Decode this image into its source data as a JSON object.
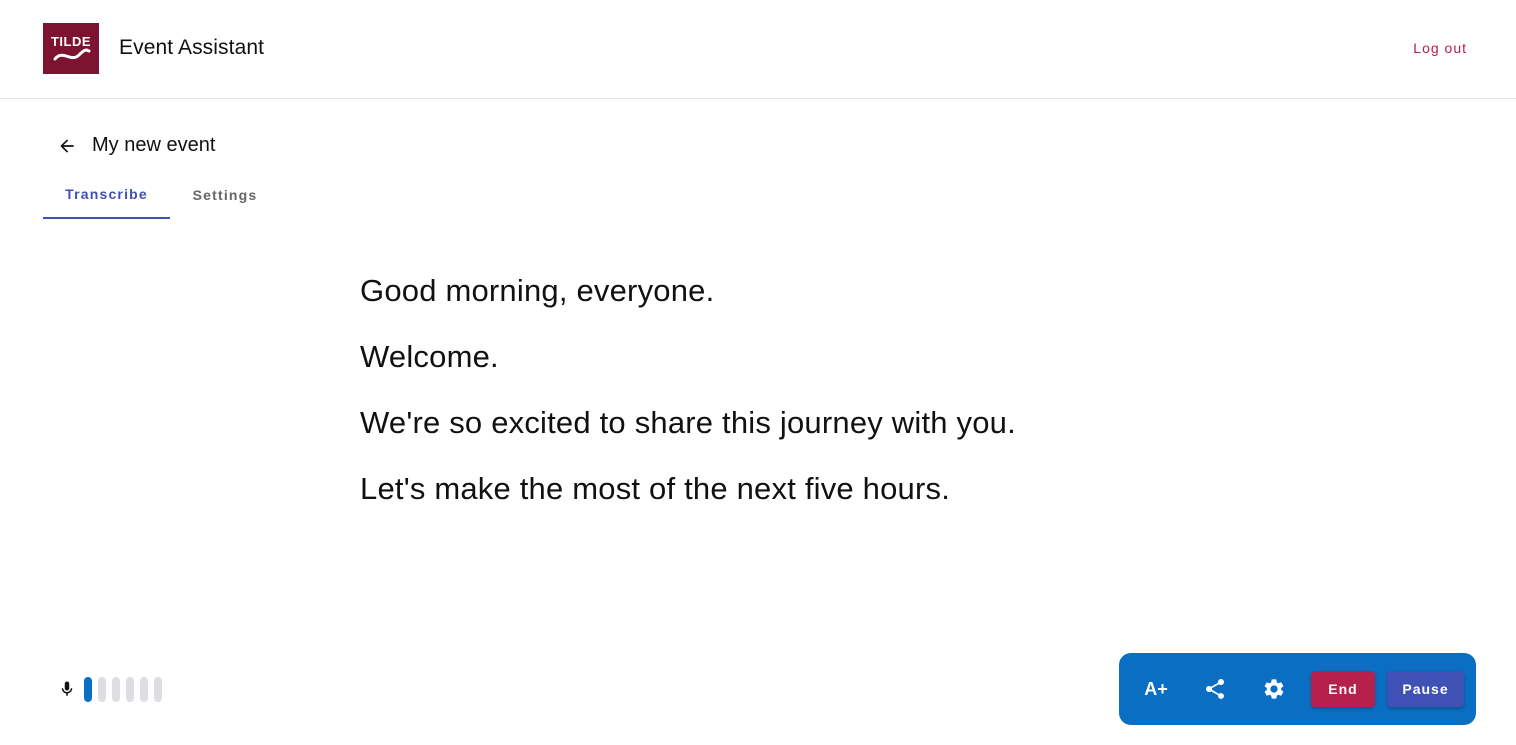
{
  "header": {
    "logo_text": "TILDE",
    "app_title": "Event Assistant",
    "logout_label": "Log out"
  },
  "event": {
    "back_icon": "arrow-left-icon",
    "title": "My new event"
  },
  "tabs": [
    {
      "label": "Transcribe",
      "active": true
    },
    {
      "label": "Settings",
      "active": false
    }
  ],
  "transcript": {
    "lines": [
      "Good morning, everyone.",
      "Welcome.",
      "We're so excited to share this journey with you.",
      "Let's make the most of the next five hours."
    ]
  },
  "mic_level": {
    "icon": "microphone-icon",
    "segments_total": 6,
    "segments_active": 1
  },
  "controls": {
    "font_size_label": "A+",
    "share_icon": "share-icon",
    "settings_icon": "gear-icon",
    "end_label": "End",
    "pause_label": "Pause"
  },
  "colors": {
    "brand": "#7d1331",
    "accent": "#3f51b5",
    "danger": "#b5204d",
    "panel": "#0a6fc2"
  }
}
